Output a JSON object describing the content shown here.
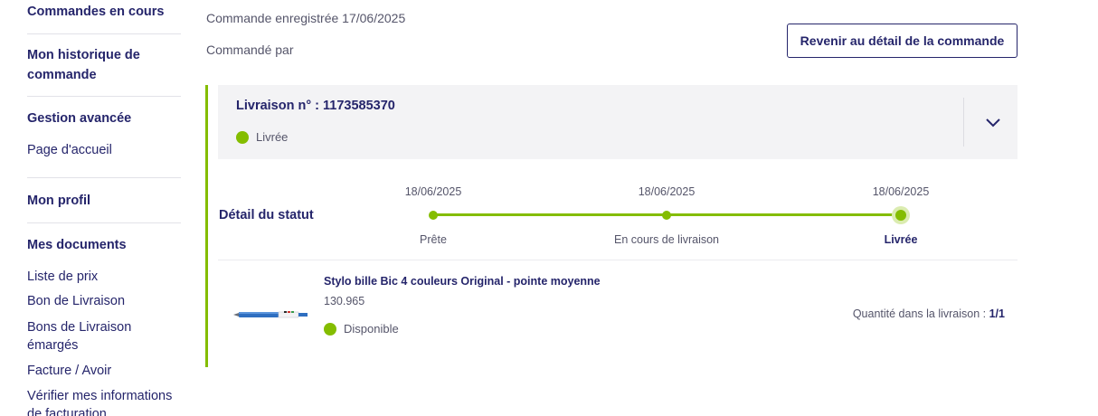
{
  "sidebar": {
    "orders_in_progress": "Commandes en cours",
    "order_history": "Mon historique de commande",
    "advanced_management": "Gestion avancée",
    "home_page": "Page d'accueil",
    "profile": "Mon profil",
    "documents": "Mes documents",
    "doc_links": [
      "Liste de prix",
      "Bon de Livraison",
      "Bons de Livraison émargés",
      "Facture / Avoir",
      "Vérifier mes informations de facturation"
    ]
  },
  "order": {
    "registered": "Commande enregistrée 17/06/2025",
    "ordered_by": "Commandé par",
    "back_button": "Revenir au détail de la commande"
  },
  "delivery": {
    "title": "Livraison n° : 1173585370",
    "status": "Livrée",
    "status_color": "#84bd00",
    "status_section_label": "Détail du statut",
    "timeline": [
      {
        "date": "18/06/2025",
        "label": "Prête"
      },
      {
        "date": "18/06/2025",
        "label": "En cours de livraison"
      },
      {
        "date": "18/06/2025",
        "label": "Livrée"
      }
    ]
  },
  "product": {
    "name": "Stylo bille Bic 4 couleurs Original - pointe moyenne",
    "reference": "130.965",
    "availability": "Disponible",
    "quantity_label": "Quantité dans la livraison : ",
    "quantity_value": "1/1"
  },
  "colors": {
    "primary": "#25256b",
    "accent_green": "#84bd00"
  }
}
